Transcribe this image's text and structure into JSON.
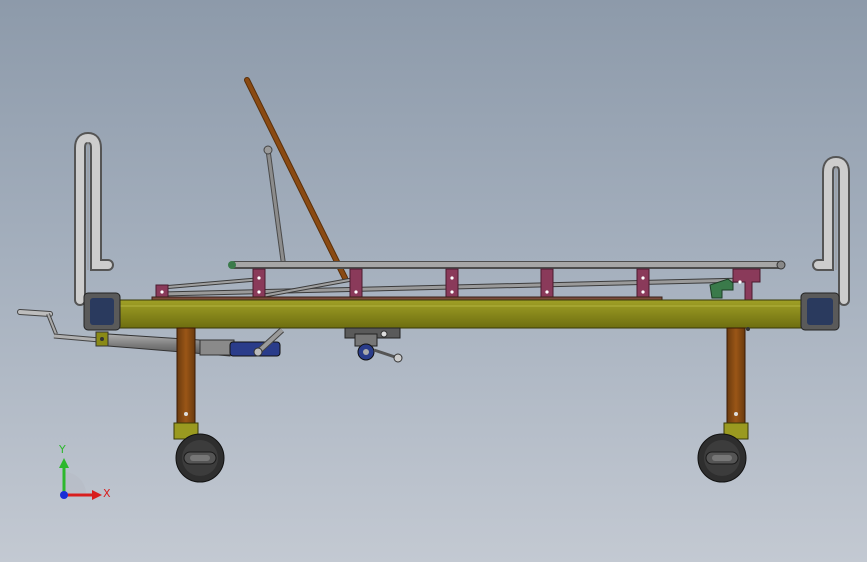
{
  "axes": {
    "y_label": "Y",
    "x_label": "X",
    "y_color": "#2db82d",
    "x_color": "#d81e1e",
    "origin_color": "#1a2fd6"
  },
  "colors": {
    "background_top": "#8d9aaa",
    "background_bottom": "#c3c9d2",
    "frame_olive": "#8a8a16",
    "deck_brown": "#7b4b3c",
    "leg_brown": "#8a4a12",
    "backrest_brown": "#8a4a12",
    "rail_gray": "#8c8c8c",
    "bracket_purple": "#8a3a5a",
    "footboard_gray": "#a8a8a8",
    "corner_block": "#2a3a5e",
    "actuator_blue": "#2a3c8a",
    "lever_green": "#3a7a4a",
    "caster_dark": "#262626",
    "caster_yoke": "#9a9a20"
  },
  "scene": {
    "subject": "hospital-bed-side-view",
    "parts": [
      "headboard",
      "footboard",
      "backrest",
      "side-rail",
      "bed-frame",
      "front-leg",
      "rear-leg",
      "front-caster",
      "rear-caster",
      "hand-crank",
      "actuator",
      "center-mechanism"
    ]
  }
}
